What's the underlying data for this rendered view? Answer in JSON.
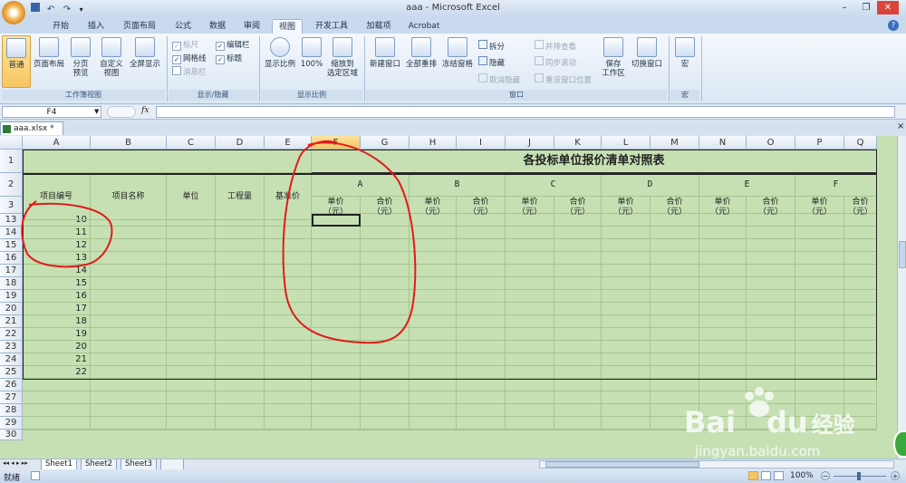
{
  "window": {
    "title": "aaa - Microsoft Excel"
  },
  "tabs": [
    "开始",
    "插入",
    "页面布局",
    "公式",
    "数据",
    "审阅",
    "视图",
    "开发工具",
    "加载项",
    "Acrobat"
  ],
  "active_tab_index": 6,
  "ribbon": {
    "workbook_views": {
      "normal": "普通",
      "page_layout": "页面布局",
      "page_break_1": "分页",
      "page_break_2": "预览",
      "custom_views_1": "自定义",
      "custom_views_2": "视图",
      "full_screen": "全屏显示",
      "group": "工作簿视图"
    },
    "show_hide": {
      "ruler": "标尺",
      "gridlines": "网格线",
      "message_bar": "消息栏",
      "formula_bar": "编辑栏",
      "headings": "标题",
      "group": "显示/隐藏"
    },
    "zoom": {
      "zoom": "显示比例",
      "hundred": "100%",
      "to_sel_1": "缩放到",
      "to_sel_2": "选定区域",
      "group": "显示比例"
    },
    "window": {
      "new": "新建窗口",
      "arrange": "全部重排",
      "freeze": "冻结窗格",
      "split": "拆分",
      "hide": "隐藏",
      "unhide": "取消隐藏",
      "side_by_side": "并排查看",
      "sync_scroll": "同步滚动",
      "reset_pos": "重设窗口位置",
      "save_ws_1": "保存",
      "save_ws_2": "工作区",
      "switch": "切换窗口",
      "group": "窗口"
    },
    "macros": {
      "macros": "宏",
      "group": "宏"
    }
  },
  "formula_bar": {
    "name_box": "F4",
    "fx": "fx"
  },
  "workbook_tab": "aaa.xlsx *",
  "columns": [
    "A",
    "B",
    "C",
    "D",
    "E",
    "F",
    "G",
    "H",
    "I",
    "J",
    "K",
    "L",
    "M",
    "N",
    "O",
    "P",
    "Q"
  ],
  "selected_column": "F",
  "rows": [
    "1",
    "2",
    "3",
    "13",
    "14",
    "15",
    "16",
    "17",
    "18",
    "19",
    "20",
    "21",
    "22",
    "23",
    "24",
    "25",
    "26",
    "27",
    "28",
    "29",
    "30"
  ],
  "sheet": {
    "title": "各投标单位报价清单对照表",
    "headers": {
      "seq": "项目编号",
      "name": "项目名称",
      "unit": "单位",
      "qty": "工程量",
      "base": "基准价"
    },
    "bidders": [
      "A",
      "B",
      "C",
      "D",
      "E",
      "F"
    ],
    "unit_price": "单价",
    "total_price": "合价",
    "currency": "（元）",
    "numbers": [
      "10",
      "11",
      "12",
      "13",
      "14",
      "15",
      "16",
      "17",
      "18",
      "19",
      "20",
      "21",
      "22"
    ]
  },
  "sheet_tabs": [
    "Sheet1",
    "Sheet2",
    "Sheet3"
  ],
  "status": {
    "ready": "就绪",
    "zoom": "100%"
  },
  "watermark": {
    "brand_1": "Bai",
    "brand_2": "du",
    "brand_cn": "经验",
    "url": "jingyan.baidu.com"
  },
  "colors": {
    "cell_fill": "#c6e0b4",
    "annotation": "#e21a1a",
    "selection": "#f4c45d"
  }
}
